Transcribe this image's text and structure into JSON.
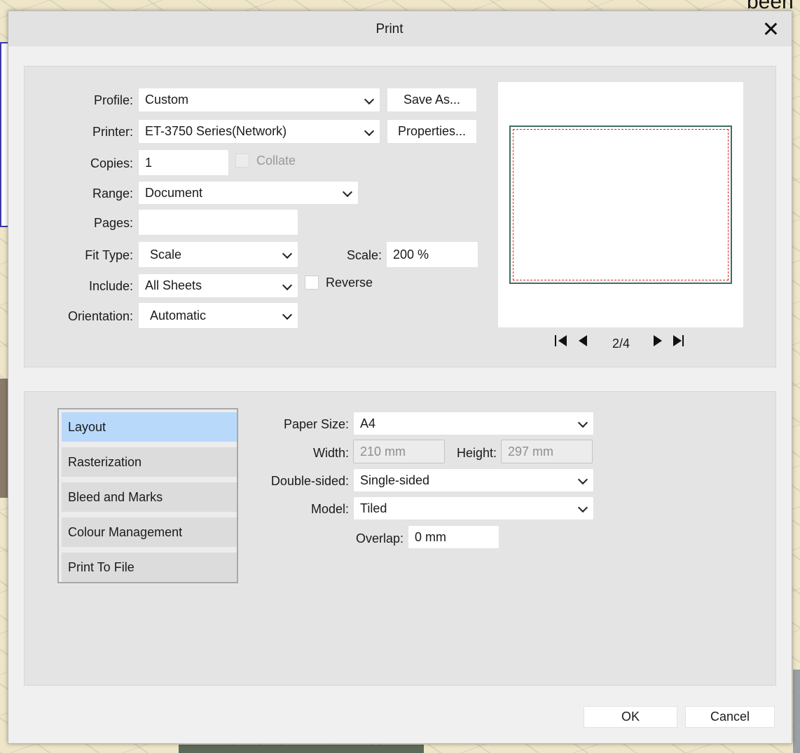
{
  "background": {
    "corner_word": "been"
  },
  "dialog": {
    "title": "Print",
    "profile": {
      "label": "Profile:",
      "value": "Custom"
    },
    "save_as_label": "Save As...",
    "printer": {
      "label": "Printer:",
      "value": "ET-3750 Series(Network)"
    },
    "properties_label": "Properties...",
    "copies": {
      "label": "Copies:",
      "value": "1"
    },
    "collate": {
      "label": "Collate",
      "checked": false,
      "enabled": false
    },
    "range": {
      "label": "Range:",
      "value": "Document"
    },
    "pages": {
      "label": "Pages:",
      "value": ""
    },
    "fit_type": {
      "label": "Fit Type:",
      "value": "Scale"
    },
    "scale": {
      "label": "Scale:",
      "value": "200 %"
    },
    "include": {
      "label": "Include:",
      "value": "All Sheets"
    },
    "reverse": {
      "label": "Reverse",
      "checked": false
    },
    "orientation": {
      "label": "Orientation:",
      "value": "Automatic"
    },
    "preview": {
      "page_indicator": "2/4"
    },
    "sections": [
      {
        "label": "Layout",
        "active": true
      },
      {
        "label": "Rasterization",
        "active": false
      },
      {
        "label": "Bleed and Marks",
        "active": false
      },
      {
        "label": "Colour Management",
        "active": false
      },
      {
        "label": "Print To File",
        "active": false
      }
    ],
    "layout": {
      "paper_size": {
        "label": "Paper Size:",
        "value": "A4"
      },
      "width": {
        "label": "Width:",
        "value": "210 mm"
      },
      "height": {
        "label": "Height:",
        "value": "297 mm"
      },
      "double_sided": {
        "label": "Double-sided:",
        "value": "Single-sided"
      },
      "model": {
        "label": "Model:",
        "value": "Tiled"
      },
      "overlap": {
        "label": "Overlap:",
        "value": "0 mm"
      }
    },
    "ok_label": "OK",
    "cancel_label": "Cancel"
  },
  "colors": {
    "active_section": "#b9d9fb",
    "preview_frame": "#3c6f63",
    "preview_margin": "#dd2222"
  }
}
